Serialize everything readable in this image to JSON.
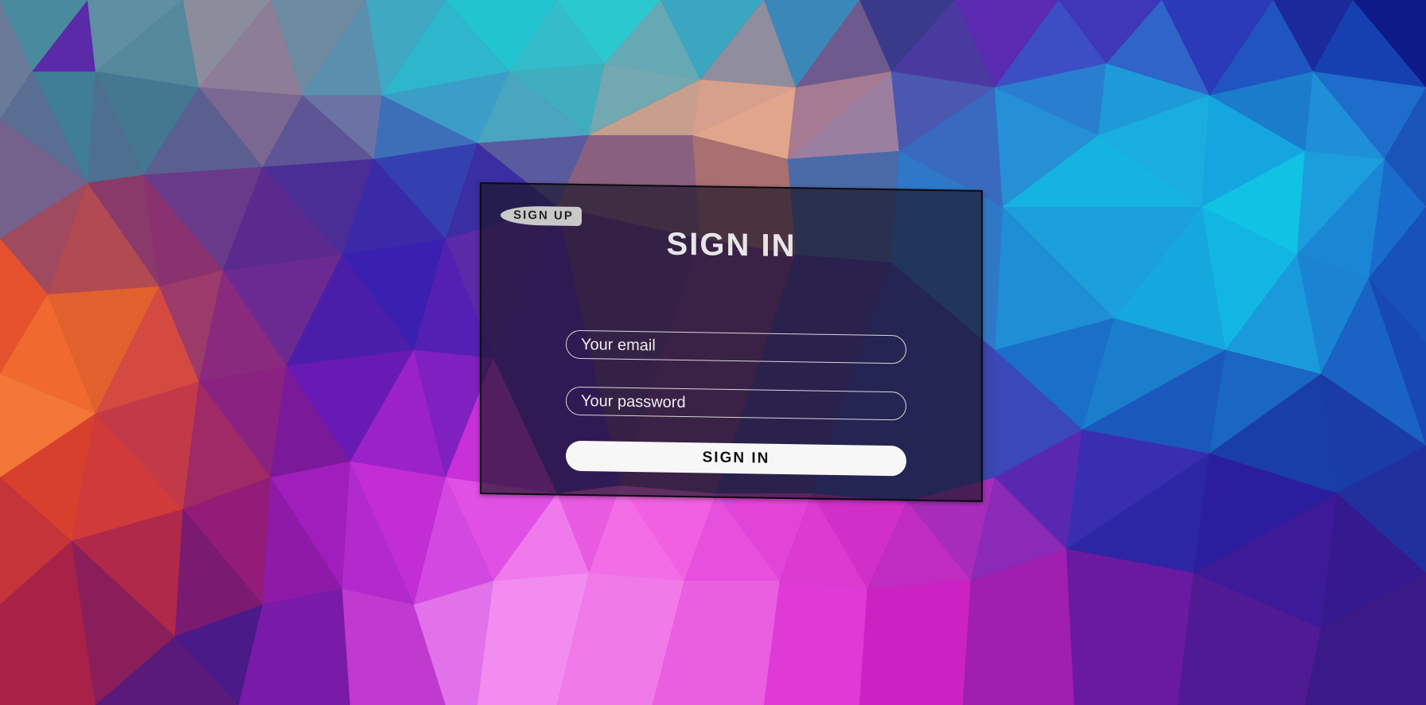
{
  "form": {
    "signup_label": "SIGN UP",
    "title": "SIGN IN",
    "email_placeholder": "Your email",
    "password_placeholder": "Your password",
    "submit_label": "SIGN IN"
  },
  "colors": {
    "panel_background": "#1c1626",
    "field_border": "#d8d8d8",
    "button_background": "#f7f7f7",
    "toggle_background": "#c9c9c9"
  }
}
